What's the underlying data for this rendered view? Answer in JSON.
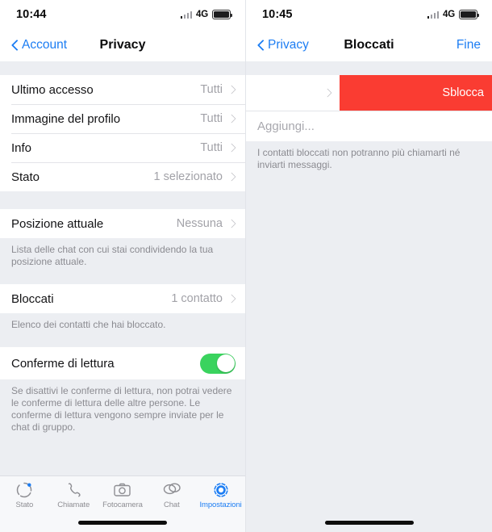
{
  "left_screen": {
    "status_bar": {
      "time": "10:44",
      "network": "4G",
      "signal_icon": "cellular-signal-icon",
      "battery_icon": "battery-full-icon"
    },
    "nav": {
      "back_label": "Account",
      "title": "Privacy",
      "back_icon": "chevron-left-icon"
    },
    "section1": [
      {
        "label": "Ultimo accesso",
        "value": "Tutti"
      },
      {
        "label": "Immagine del profilo",
        "value": "Tutti"
      },
      {
        "label": "Info",
        "value": "Tutti"
      },
      {
        "label": "Stato",
        "value": "1 selezionato"
      }
    ],
    "section2": {
      "rows": [
        {
          "label": "Posizione attuale",
          "value": "Nessuna"
        }
      ],
      "footnote": "Lista delle chat con cui stai condividendo la tua posizione attuale."
    },
    "section3": {
      "rows": [
        {
          "label": "Bloccati",
          "value": "1 contatto"
        }
      ],
      "footnote": "Elenco dei contatti che hai bloccato."
    },
    "section4": {
      "label": "Conferme di lettura",
      "toggle_state": "on",
      "footnote": "Se disattivi le conferme di lettura, non potrai vedere le conferme di lettura delle altre persone. Le conferme di lettura vengono sempre inviate per le chat di gruppo."
    },
    "tabs": [
      {
        "label": "Stato",
        "icon": "status-ring-icon",
        "active": false
      },
      {
        "label": "Chiamate",
        "icon": "phone-icon",
        "active": false
      },
      {
        "label": "Fotocamera",
        "icon": "camera-icon",
        "active": false
      },
      {
        "label": "Chat",
        "icon": "chat-bubbles-icon",
        "active": false
      },
      {
        "label": "Impostazioni",
        "icon": "gear-icon",
        "active": true
      }
    ]
  },
  "right_screen": {
    "status_bar": {
      "time": "10:45",
      "network": "4G",
      "signal_icon": "cellular-signal-icon",
      "battery_icon": "battery-full-icon"
    },
    "nav": {
      "back_label": "Privacy",
      "title": "Bloccati",
      "right_label": "Fine",
      "back_icon": "chevron-left-icon"
    },
    "swipe_row": {
      "action_label": "Sblocca",
      "chevron_icon": "chevron-right-icon"
    },
    "add_row": {
      "placeholder": "Aggiungi..."
    },
    "footnote": "I contatti bloccati non potranno più chiamarti né inviarti messaggi."
  },
  "colors": {
    "accent_blue": "#1c7df3",
    "destructive_red": "#fa3c32",
    "toggle_green": "#3ad35e",
    "background_gray": "#eceef2"
  }
}
